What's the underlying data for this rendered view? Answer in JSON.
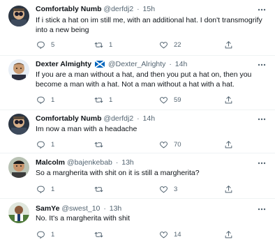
{
  "tweets": [
    {
      "name": "Comfortably Numb",
      "handle": "@derfdj2",
      "time": "15h",
      "text": "If i stick a hat on im still me, with an additional hat. I don't transmogrify into a new being",
      "replies": "5",
      "retweets": "1",
      "likes": "22"
    },
    {
      "name": "Dexter Almighty",
      "handle": "@Dexter_Alrighty",
      "time": "14h",
      "text": "If you are a man without a hat, and then you put a hat on, then you become a man with a hat. Not a man without a hat with a hat.",
      "replies": "1",
      "retweets": "1",
      "likes": "59"
    },
    {
      "name": "Comfortably Numb",
      "handle": "@derfdj2",
      "time": "14h",
      "text": "Im now a man with a headache",
      "replies": "1",
      "retweets": "",
      "likes": "70"
    },
    {
      "name": "Malcolm",
      "handle": "@bajenkebab",
      "time": "13h",
      "text": "So a margherita with shit on it is still a margherita?",
      "replies": "1",
      "retweets": "",
      "likes": "3"
    },
    {
      "name": "SamYe",
      "handle": "@swest_10",
      "time": "13h",
      "text": "No. It's a margherita with shit",
      "replies": "1",
      "retweets": "",
      "likes": "14"
    }
  ],
  "separator": "·",
  "icons": {
    "reply": "reply-icon",
    "retweet": "retweet-icon",
    "like": "heart-icon",
    "share": "share-icon",
    "more": "more-icon",
    "flag": "scotland-flag-icon"
  },
  "colors": {
    "text": "#0f1419",
    "secondary": "#536471",
    "divider": "#eff3f4",
    "flag_blue": "#0065bd"
  }
}
